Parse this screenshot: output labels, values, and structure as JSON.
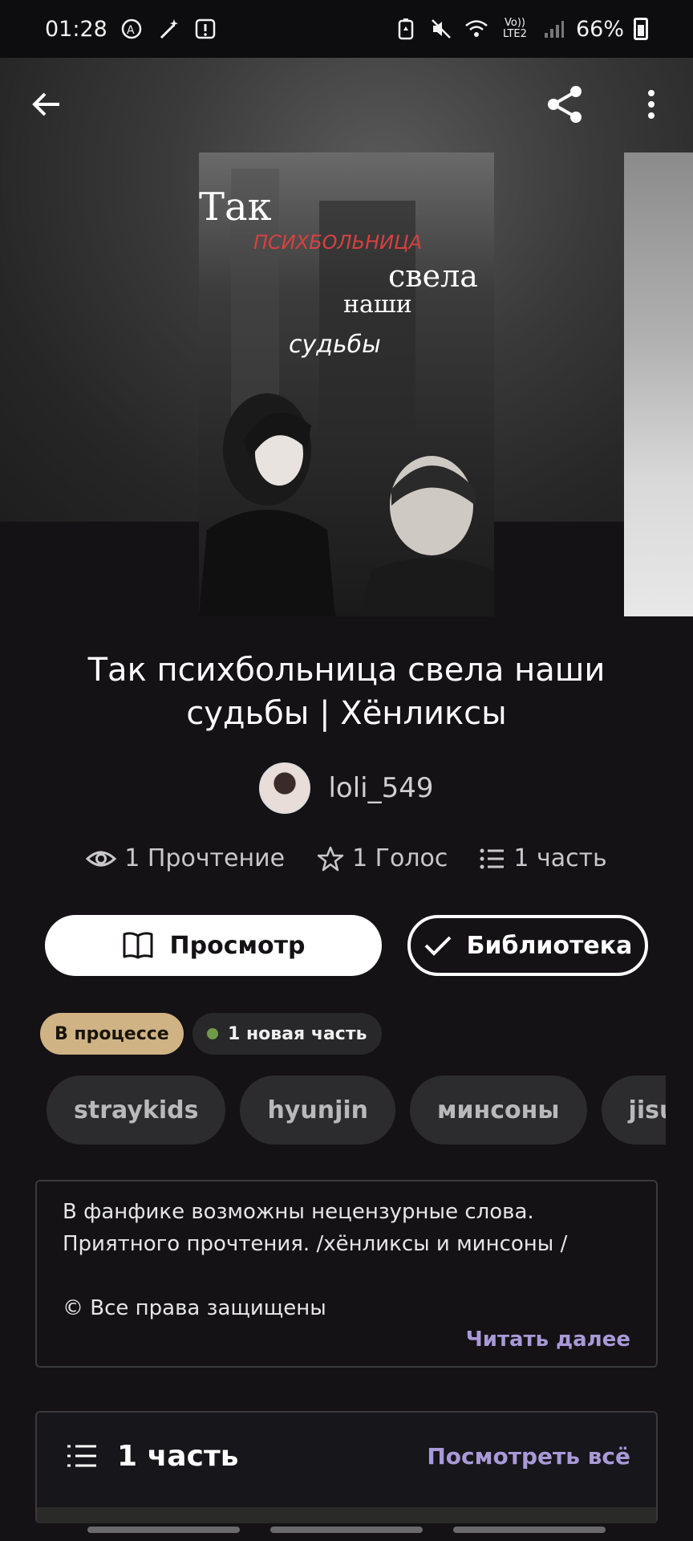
{
  "status_bar": {
    "time": "01:28",
    "battery": "66%",
    "network": "Vo)) LTE2"
  },
  "cover": {
    "line1": "Так",
    "line2": "ПСИХБОЛЬНИЦА",
    "line3": "свела",
    "line4": "наши",
    "line5": "судьбы"
  },
  "story": {
    "title": "Так психбольница свела наши судьбы | Хёнликсы",
    "author": "loli_549"
  },
  "stats": {
    "reads": "1 Прочтение",
    "votes": "1 Голос",
    "parts": "1 часть"
  },
  "actions": {
    "preview_label": "Просмотр",
    "library_label": "Библиотека"
  },
  "badges": {
    "status": "В процессе",
    "new_part": "1 новая часть"
  },
  "tags": [
    "straykids",
    "hyunjin",
    "минсоны",
    "jisung"
  ],
  "description": {
    "line1": "В фанфике возможны нецензурные слова.",
    "line2": "Приятного прочтения. /хёнликсы и минсоны /",
    "line3": "© Все права защищены",
    "read_more": "Читать далее"
  },
  "parts_section": {
    "title": "1 часть",
    "see_all": "Посмотреть всё"
  },
  "colors": {
    "background": "#141215",
    "accent_link": "#a999d8",
    "status_badge": "#cfb384",
    "new_dot": "#6f9a4a"
  }
}
